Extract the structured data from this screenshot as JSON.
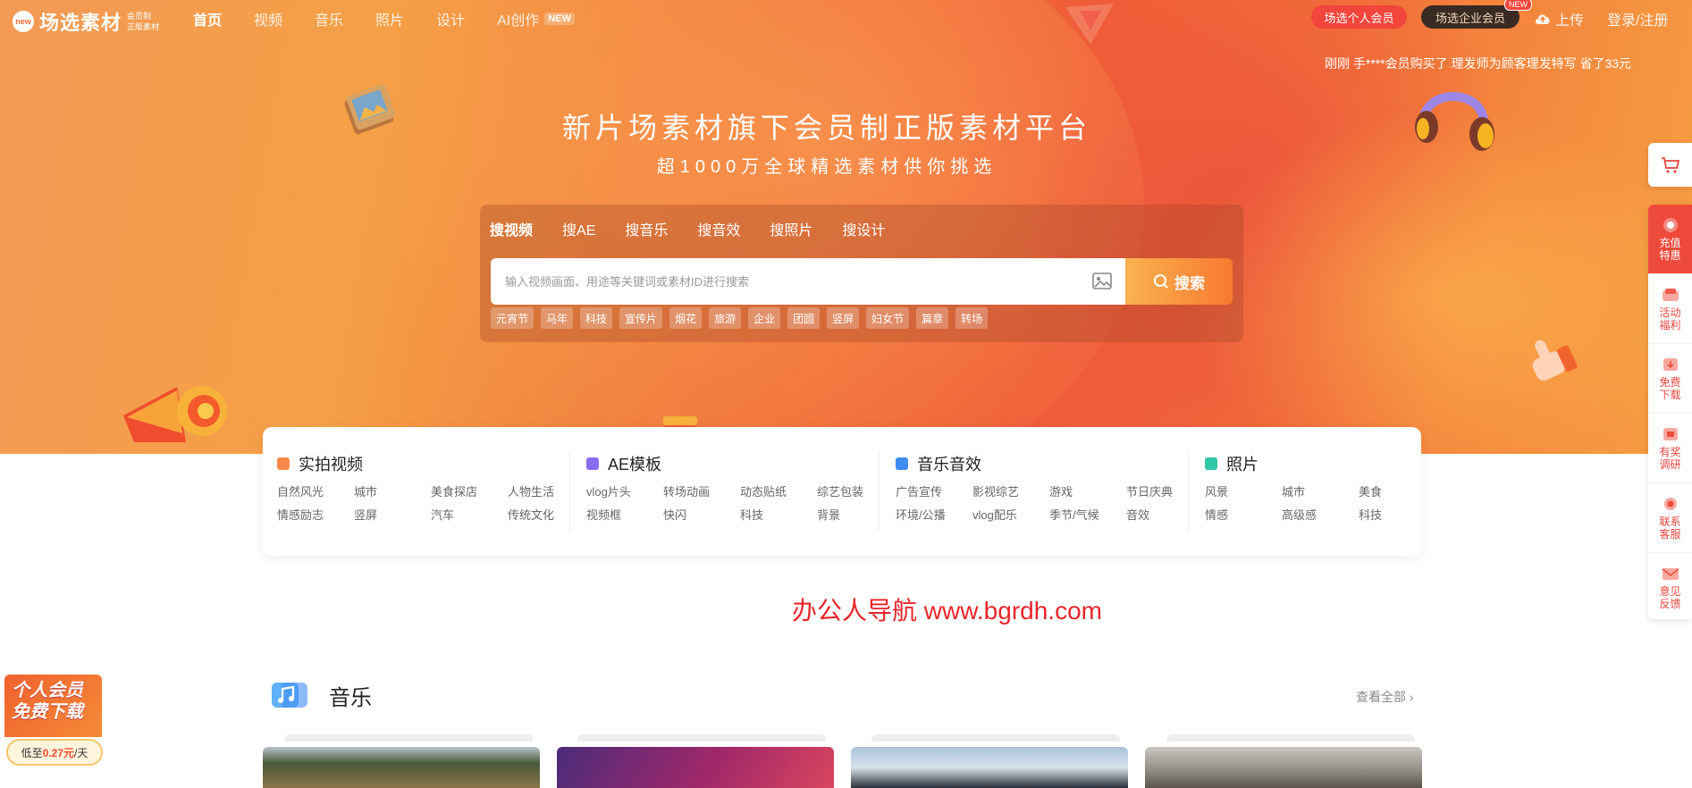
{
  "nav": {
    "logo_badge": "new",
    "logo_text": "场选素材",
    "logo_sub1": "会员制",
    "logo_sub2": "正版素材",
    "links": [
      {
        "label": "首页",
        "active": true
      },
      {
        "label": "视频"
      },
      {
        "label": "音乐"
      },
      {
        "label": "照片"
      },
      {
        "label": "设计"
      },
      {
        "label": "AI创作",
        "tag": "NEW"
      }
    ],
    "personal_btn": "场选个人会员",
    "enterprise_btn": "场选企业会员",
    "enterprise_tag": "NEW",
    "upload": "上传",
    "login": "登录/注册"
  },
  "ticker": "刚刚 手****会员购买了 理发师为顾客理发特写 省了33元",
  "hero": {
    "title": "新片场素材旗下会员制正版素材平台",
    "subtitle": "超1000万全球精选素材供你挑选"
  },
  "search": {
    "tabs": [
      "搜视频",
      "搜AE",
      "搜音乐",
      "搜音效",
      "搜照片",
      "搜设计"
    ],
    "placeholder": "输入视频画面、用途等关键词或素材ID进行搜索",
    "button": "搜索",
    "chips": [
      "元宵节",
      "马年",
      "科技",
      "宣传片",
      "烟花",
      "旅游",
      "企业",
      "团圆",
      "竖屏",
      "妇女节",
      "篇章",
      "转场"
    ]
  },
  "sidebar": {
    "items": [
      {
        "label": "充值特惠",
        "icon": "gift-icon"
      },
      {
        "label": "活动福利",
        "icon": "coupon-icon"
      },
      {
        "label": "免费下载",
        "icon": "download-icon"
      },
      {
        "label": "有奖调研",
        "icon": "survey-icon"
      },
      {
        "label": "联系客服",
        "icon": "headset-icon"
      },
      {
        "label": "意见反馈",
        "icon": "mail-icon"
      }
    ]
  },
  "categories": [
    {
      "title": "实拍视频",
      "color": "#f7894a",
      "links": [
        "自然风光",
        "城市",
        "美食探店",
        "人物生活",
        "情感励志",
        "竖屏",
        "汽车",
        "传统文化"
      ]
    },
    {
      "title": "AE模板",
      "color": "#8a6cf0",
      "links": [
        "vlog片头",
        "转场动画",
        "动态贴纸",
        "综艺包装",
        "视频框",
        "快闪",
        "科技",
        "背景"
      ]
    },
    {
      "title": "音乐音效",
      "color": "#3f8cf2",
      "links": [
        "广告宣传",
        "影视综艺",
        "游戏",
        "节日庆典",
        "环境/公播",
        "vlog配乐",
        "季节/气候",
        "音效"
      ]
    },
    {
      "title": "照片",
      "color": "#2fc7a8",
      "links": [
        "风景",
        "城市",
        "美食",
        "情感",
        "高级感",
        "科技"
      ]
    }
  ],
  "watermark": "办公人导航 www.bgrdh.com",
  "music": {
    "title": "音乐",
    "see_all": "查看全部"
  },
  "promo": {
    "line1": "个人会员",
    "line2": "免费下载",
    "price_prefix": "低至",
    "price": "0.27元",
    "price_suffix": "/天"
  },
  "colors": {
    "accent": "#f2453b",
    "brand_orange": "#f87a2f"
  }
}
